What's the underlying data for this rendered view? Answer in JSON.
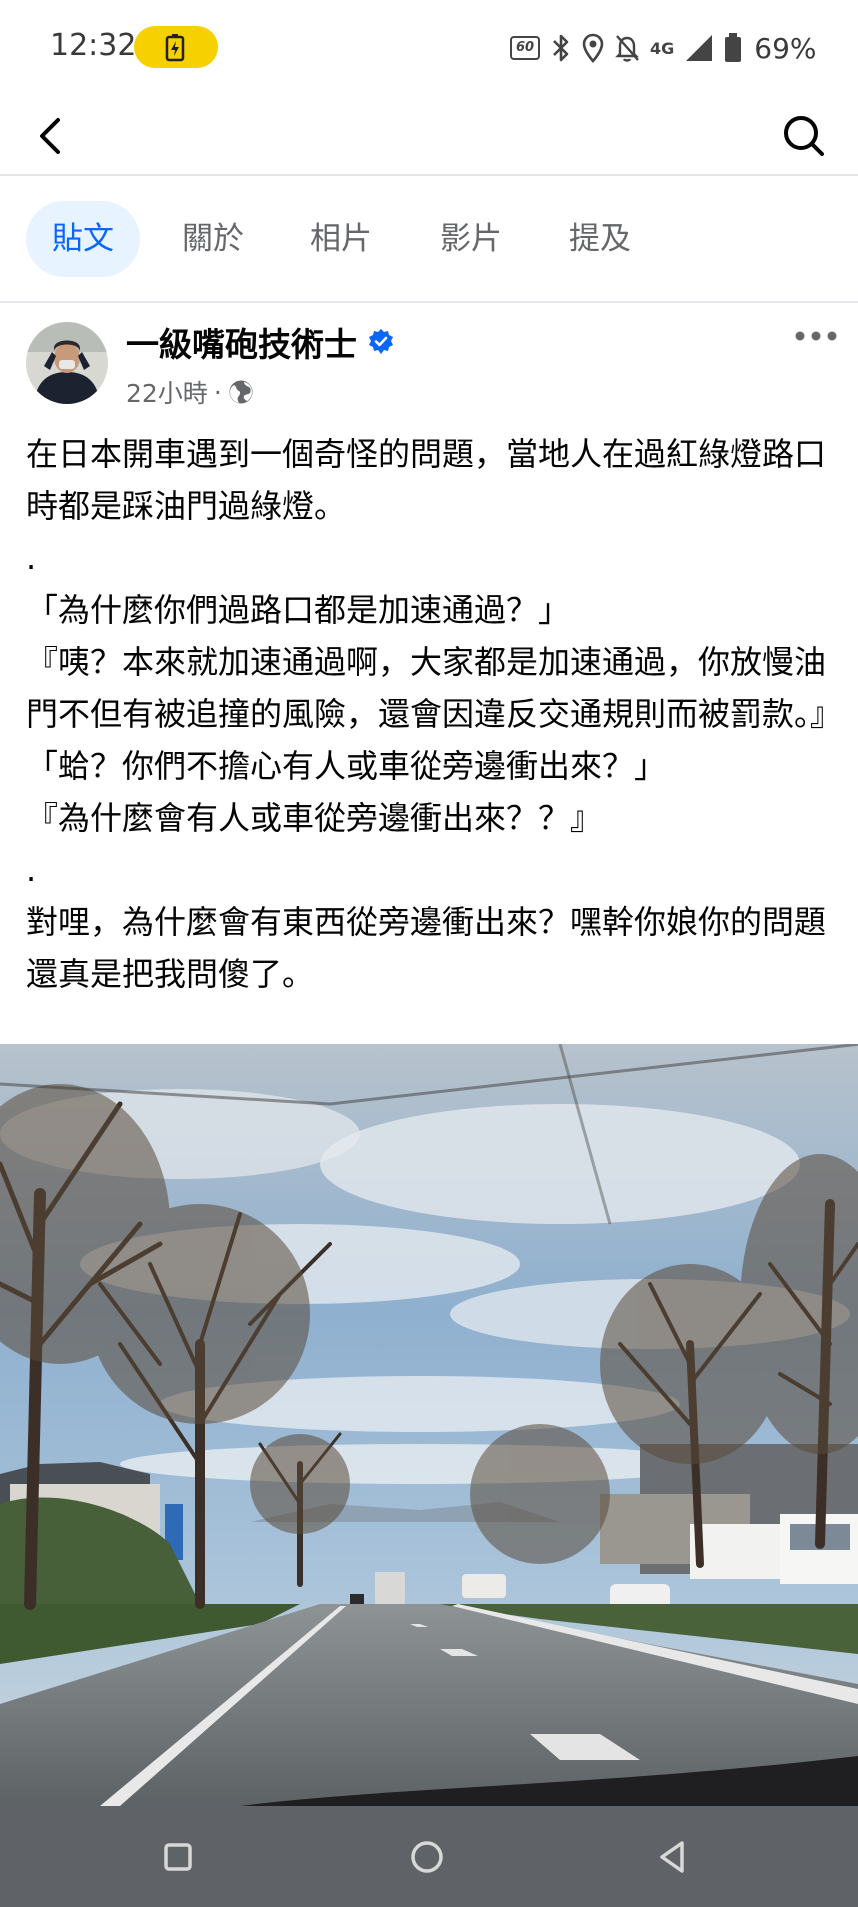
{
  "status_bar": {
    "time": "12:32",
    "refresh_rate": "60",
    "network": "4G",
    "battery_percent": "69%",
    "charging_pill_color": "#f7d000"
  },
  "app_bar": {
    "back_icon": "chevron-left-icon",
    "search_icon": "search-icon"
  },
  "tabs": [
    {
      "label": "貼文",
      "active": true
    },
    {
      "label": "關於",
      "active": false
    },
    {
      "label": "相片",
      "active": false
    },
    {
      "label": "影片",
      "active": false
    },
    {
      "label": "提及",
      "active": false
    }
  ],
  "post": {
    "author": "一級嘴砲技術士",
    "verified": true,
    "time_ago": "22小時",
    "separator": "·",
    "privacy_icon": "globe-icon",
    "paragraphs": [
      "在日本開車遇到一個奇怪的問題，當地人在過紅綠燈路口時都是踩油門過綠燈。",
      ".",
      "「為什麼你們過路口都是加速通過？」",
      "『咦？本來就加速通過啊，大家都是加速通過，你放慢油門不但有被追撞的風險，還會因違反交通規則而被罰款。』",
      "「蛤？你們不擔心有人或車從旁邊衝出來？」",
      "『為什麼會有人或車從旁邊衝出來？？』",
      ".",
      "對哩，為什麼會有東西從旁邊衝出來？嘿幹你娘你的問題還真是把我問傻了。"
    ]
  },
  "colors": {
    "accent": "#0866ff",
    "tab_active_bg": "#e7f3ff",
    "secondary_text": "#65676b",
    "nav_bar": "#5f6368"
  }
}
